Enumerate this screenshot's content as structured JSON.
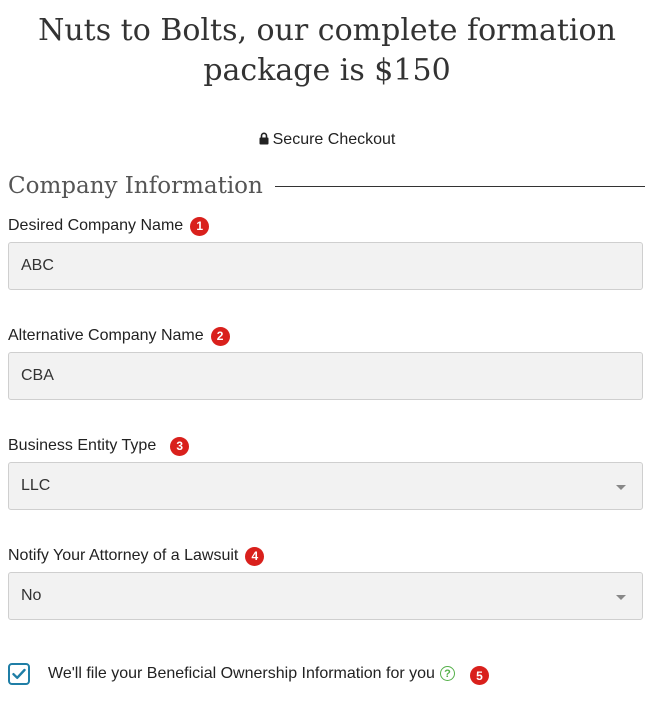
{
  "header": {
    "title_line1": "Nuts to Bolts, our complete formation",
    "title_line2": "package is $150",
    "secure_label": "Secure Checkout",
    "lock_icon": "lock-icon"
  },
  "section": {
    "title": "Company Information"
  },
  "fields": [
    {
      "label": "Desired Company Name",
      "badge": "1",
      "value": "ABC",
      "type": "text"
    },
    {
      "label": "Alternative Company Name",
      "badge": "2",
      "value": "CBA",
      "type": "text"
    },
    {
      "label": "Business Entity Type",
      "badge": "3",
      "value": "LLC",
      "type": "select"
    },
    {
      "label": "Notify Your Attorney of a Lawsuit",
      "badge": "4",
      "value": "No",
      "type": "select"
    }
  ],
  "boi": {
    "label": "We'll file your Beneficial Ownership Information for you",
    "checked": true,
    "help_glyph": "?",
    "badge": "5"
  },
  "colors": {
    "badge": "#d9201c",
    "checkbox_accent": "#1f7ea6",
    "help_icon": "#55b04a",
    "field_bg": "#f2f2f2"
  }
}
